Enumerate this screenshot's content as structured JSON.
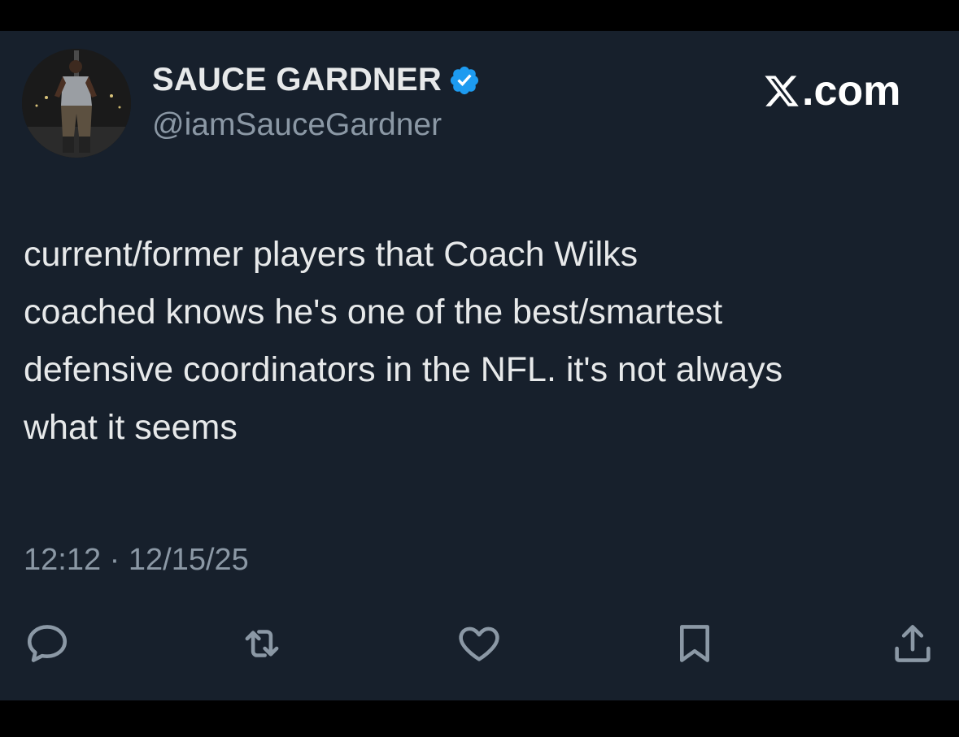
{
  "author": {
    "display_name": "SAUCE GARDNER",
    "handle": "@iamSauceGardner",
    "verified": true,
    "avatar_icon": "avatar-photo"
  },
  "brand": {
    "label": ".com",
    "icon": "x-logo-icon"
  },
  "tweet": {
    "text": "current/former players that Coach Wilks\ncoached knows he's one of the best/smartest\ndefensive coordinators in the NFL. it's not always\nwhat it seems",
    "timestamp": "12:12 · 12/15/25"
  },
  "actions": [
    {
      "name": "reply",
      "icon": "reply-icon"
    },
    {
      "name": "repost",
      "icon": "repost-icon"
    },
    {
      "name": "like",
      "icon": "heart-icon"
    },
    {
      "name": "bookmark",
      "icon": "bookmark-icon"
    },
    {
      "name": "share",
      "icon": "share-icon"
    }
  ],
  "colors": {
    "background": "#17202c",
    "text_primary": "#e7e9ea",
    "text_secondary": "#8b98a5",
    "verified_badge": "#1d9bf0"
  }
}
